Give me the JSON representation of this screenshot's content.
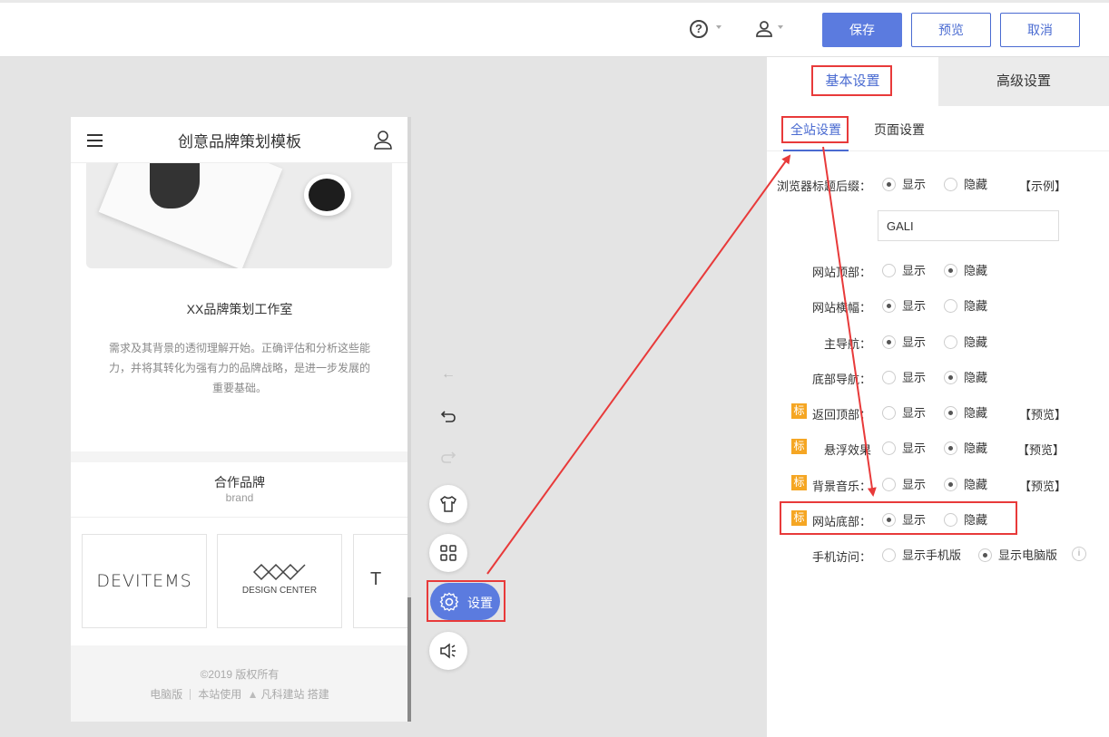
{
  "topbar": {
    "help_icon": "help-circle-icon",
    "user_icon": "user-icon",
    "save_label": "保存",
    "preview_label": "预览",
    "cancel_label": "取消"
  },
  "phone": {
    "title": "创意品牌策划模板",
    "studio_title": "XX品牌策划工作室",
    "studio_desc": "需求及其背景的透彻理解开始。正确评估和分析这些能力，并将其转化为强有力的品牌战略，是进一步发展的重要基础。",
    "brand_title": "合作品牌",
    "brand_sub": "brand",
    "logos": [
      {
        "text": "DEVITEMS"
      },
      {
        "text": "DESIGN CENTER"
      },
      {
        "text": "T"
      }
    ],
    "copyright": "©2019 版权所有",
    "footer_desktop": "电脑版",
    "footer_powered_prefix": "本站使用",
    "footer_powered_brand": "凡科建站 搭建"
  },
  "tools": {
    "settings_label": "设置"
  },
  "panel": {
    "tab_basic": "基本设置",
    "tab_advanced": "高级设置",
    "subtab_site": "全站设置",
    "subtab_page": "页面设置",
    "show": "显示",
    "hide": "隐藏",
    "badge": "标",
    "rows": [
      {
        "label": "浏览器标题后缀：",
        "selected": "show",
        "extra": "【示例】"
      },
      {
        "label": "网站顶部：",
        "selected": "hide"
      },
      {
        "label": "网站横幅：",
        "selected": "show"
      },
      {
        "label": "主导航：",
        "selected": "show"
      },
      {
        "label": "底部导航：",
        "selected": "hide"
      },
      {
        "label": "返回顶部：",
        "selected": "hide",
        "extra": "【预览】"
      },
      {
        "label": "悬浮效果",
        "selected": "hide",
        "extra": "【预览】"
      },
      {
        "label": "背景音乐：",
        "selected": "hide",
        "extra": "【预览】"
      },
      {
        "label": "网站底部：",
        "selected": "show"
      }
    ],
    "title_suffix_value": "GALI",
    "mobile_label": "手机访问：",
    "mobile_opt1": "显示手机版",
    "mobile_opt2": "显示电脑版",
    "mobile_selected": "desktop"
  },
  "colors": {
    "accent": "#5b7bdf",
    "annotation": "#e83a3a",
    "badge": "#f5a623"
  }
}
